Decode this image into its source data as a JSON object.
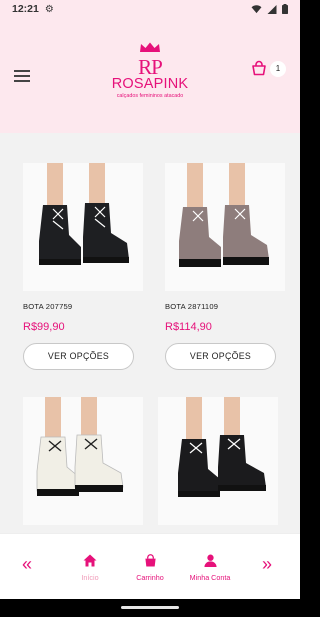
{
  "status_bar": {
    "time": "12:21",
    "settings_icon": "gear-icon",
    "wifi_icon": "wifi-icon",
    "signal_icon": "signal-icon",
    "battery_icon": "battery-icon"
  },
  "header": {
    "menu_icon": "hamburger-menu-icon",
    "logo": {
      "monogram": "RP",
      "name": "ROSAPINK",
      "tagline": "calçados femininos atacado"
    },
    "cart_icon": "shopping-bag-icon",
    "cart_count": "1"
  },
  "products": [
    {
      "name": "BOTA 207759",
      "price": "R$99,90",
      "button": "VER OPÇÕES",
      "boot_color": "#1e1f22"
    },
    {
      "name": "BOTA 2871109",
      "price": "R$114,90",
      "button": "VER OPÇÕES",
      "boot_color": "#8e7d7c"
    },
    {
      "name": "",
      "price": "",
      "button": "",
      "boot_color": "#f1efe6"
    },
    {
      "name": "",
      "price": "",
      "button": "",
      "boot_color": "#1b1b1d"
    }
  ],
  "bottom_nav": {
    "prev_icon": "double-chevron-left-icon",
    "next_icon": "double-chevron-right-icon",
    "items": [
      {
        "label": "Início",
        "icon": "home-icon"
      },
      {
        "label": "Carrinho",
        "icon": "shopping-bag-icon"
      },
      {
        "label": "Minha Conta",
        "icon": "user-icon"
      }
    ]
  },
  "colors": {
    "brand": "#e6117a",
    "header_bg": "#fde8ee",
    "page_bg": "#f2f2f2"
  }
}
